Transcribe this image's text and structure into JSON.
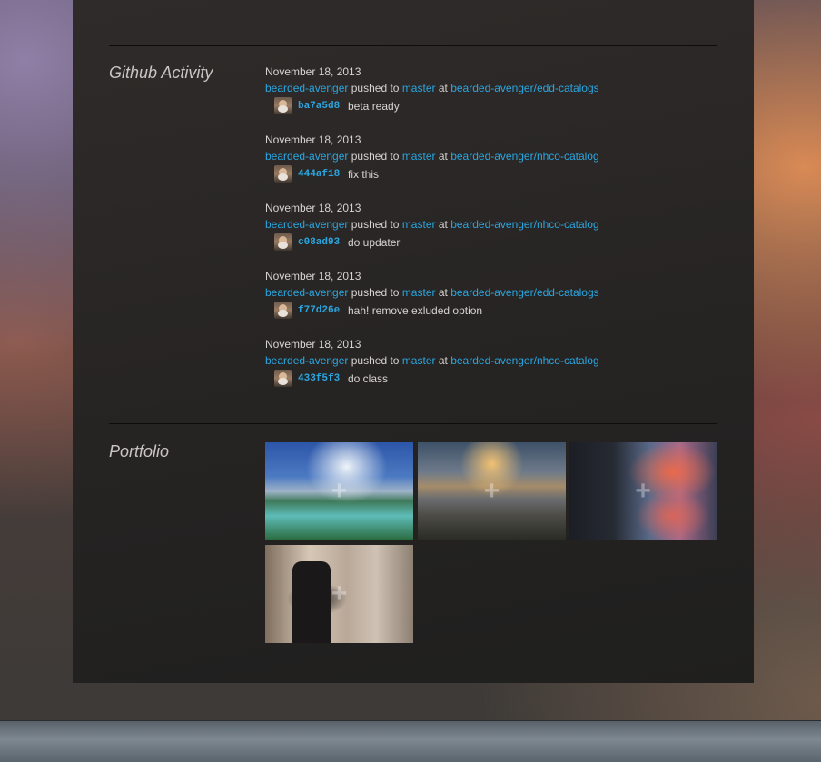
{
  "github": {
    "title": "Github Activity",
    "events": [
      {
        "date": "November 18, 2013",
        "user": "bearded-avenger",
        "action": "pushed to",
        "branch": "master",
        "at": "at",
        "repo": "bearded-avenger/edd-catalogs",
        "sha": "ba7a5d8",
        "message": "beta ready"
      },
      {
        "date": "November 18, 2013",
        "user": "bearded-avenger",
        "action": "pushed to",
        "branch": "master",
        "at": "at",
        "repo": "bearded-avenger/nhco-catalog",
        "sha": "444af18",
        "message": "fix this"
      },
      {
        "date": "November 18, 2013",
        "user": "bearded-avenger",
        "action": "pushed to",
        "branch": "master",
        "at": "at",
        "repo": "bearded-avenger/nhco-catalog",
        "sha": "c08ad93",
        "message": "do updater"
      },
      {
        "date": "November 18, 2013",
        "user": "bearded-avenger",
        "action": "pushed to",
        "branch": "master",
        "at": "at",
        "repo": "bearded-avenger/edd-catalogs",
        "sha": "f77d26e",
        "message": "hah! remove exluded option"
      },
      {
        "date": "November 18, 2013",
        "user": "bearded-avenger",
        "action": "pushed to",
        "branch": "master",
        "at": "at",
        "repo": "bearded-avenger/nhco-catalog",
        "sha": "433f5f3",
        "message": "do class"
      }
    ]
  },
  "portfolio": {
    "title": "Portfolio",
    "plus_glyph": "+",
    "items": [
      {
        "icon": "waterfall-photo"
      },
      {
        "icon": "mountain-sunset-photo"
      },
      {
        "icon": "lake-sunset-photo"
      },
      {
        "icon": "couple-subway-photo"
      }
    ]
  },
  "colors": {
    "link": "#2aa6e0",
    "text": "#d6d3d0",
    "panel": "#2a2726"
  }
}
